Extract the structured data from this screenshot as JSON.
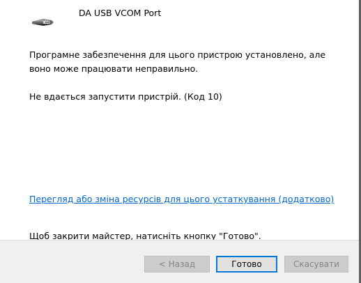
{
  "device": {
    "name": "DA USB VCOM Port",
    "icon": "usb-connector-icon"
  },
  "messages": {
    "status": "Програмне забезпечення для цього пристрою установлено, але воно може працювати неправильно.",
    "error": "Не вдається запустити пристрій. (Код 10)",
    "resources_link": "Перегляд або зміна ресурсів для цього устаткування (додатково)",
    "close_hint": "Щоб закрити майстер, натисніть кнопку \"Готово\"."
  },
  "buttons": {
    "back": "< Назад",
    "finish": "Готово",
    "cancel": "Скасувати"
  },
  "colors": {
    "link": "#0066cc",
    "focus_border": "#0078d7",
    "footer_bg": "#f0f0f0"
  }
}
